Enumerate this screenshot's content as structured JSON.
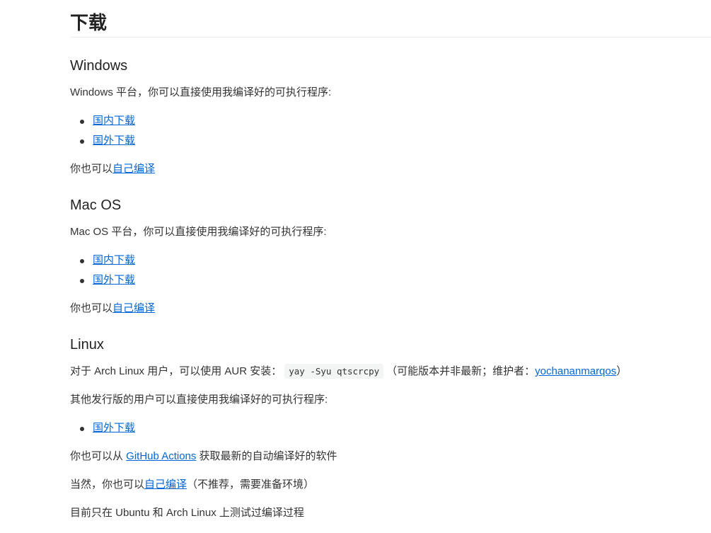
{
  "page_title": "下载",
  "windows": {
    "heading": "Windows",
    "intro": "Windows 平台，你可以直接使用我编译好的可执行程序:",
    "links": [
      "国内下载",
      "国外下载"
    ],
    "self_prefix": "你也可以",
    "self_link": "自己编译"
  },
  "macos": {
    "heading": "Mac OS",
    "intro": "Mac OS 平台，你可以直接使用我编译好的可执行程序:",
    "links": [
      "国内下载",
      "国外下载"
    ],
    "self_prefix": "你也可以",
    "self_link": "自己编译"
  },
  "linux": {
    "heading": "Linux",
    "arch_prefix": "对于 Arch Linux 用户，可以使用 AUR 安装：",
    "arch_command": "yay -Syu qtscrcpy",
    "arch_note_prefix": "（可能版本并非最新；维护者：",
    "maintainer_link": "yochananmarqos",
    "arch_note_suffix": "）",
    "other_intro": "其他发行版的用户可以直接使用我编译好的可执行程序:",
    "links": [
      "国外下载"
    ],
    "actions_prefix": "你也可以从 ",
    "actions_link": "GitHub Actions",
    "actions_suffix": " 获取最新的自动编译好的软件",
    "self_prefix": "当然，你也可以",
    "self_link": "自己编译",
    "self_suffix": "（不推荐，需要准备环境）",
    "tested_note": "目前只在 Ubuntu 和 Arch Linux 上测试过编译过程"
  }
}
